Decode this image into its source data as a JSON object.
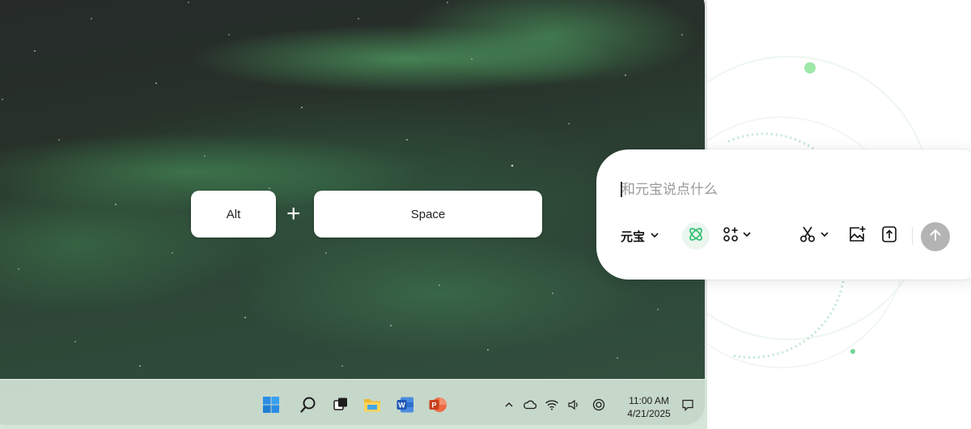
{
  "shortcut": {
    "key1": "Alt",
    "plus": "+",
    "key2": "Space"
  },
  "taskbar": {
    "apps": [
      {
        "name": "windows-start",
        "icon": "windows-logo-icon"
      },
      {
        "name": "search",
        "icon": "search-icon"
      },
      {
        "name": "task-view",
        "icon": "task-view-icon"
      },
      {
        "name": "file-explorer",
        "icon": "folder-icon"
      },
      {
        "name": "word",
        "icon": "word-icon"
      },
      {
        "name": "powerpoint",
        "icon": "powerpoint-icon"
      }
    ],
    "tray": [
      "chevron-up-icon",
      "cloud-icon",
      "wifi-icon",
      "volume-icon",
      "app-tray-icon"
    ],
    "time": "11:00 AM",
    "date": "4/21/2025"
  },
  "chat": {
    "placeholder": "和元宝说点什么",
    "model_label": "元宝",
    "accent": "#2fbf71",
    "tools": [
      "deep-think-icon",
      "apps-plus-icon",
      "scissors-icon",
      "image-add-icon",
      "upload-file-icon"
    ],
    "send_icon": "arrow-up-icon"
  },
  "colors": {
    "wallpaper": "#2c3f33",
    "taskbar": "#d3e4d6",
    "send_disabled": "#b4b4b4"
  }
}
